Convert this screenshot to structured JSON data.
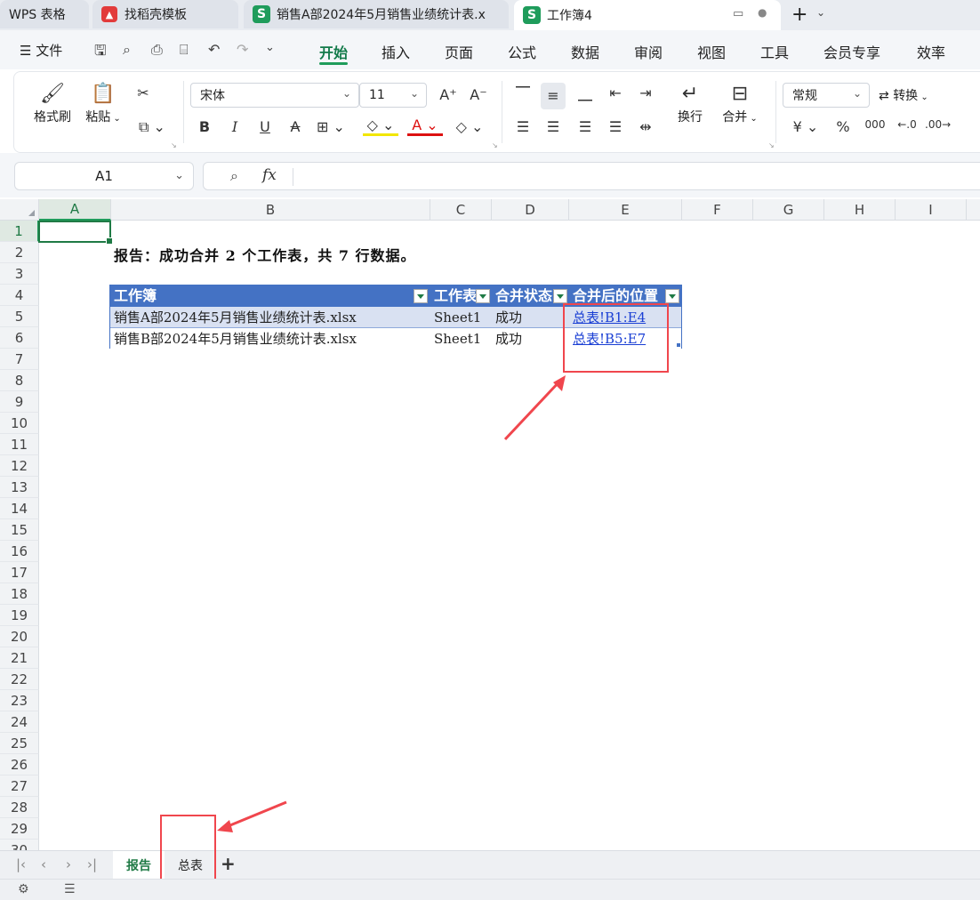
{
  "title_tabs": [
    {
      "label": "WPS 表格",
      "icon": "wps-icon"
    },
    {
      "label": "找稻壳模板",
      "icon": "docer-icon"
    },
    {
      "label": "销售A部2024年5月销售业绩统计表.x",
      "icon": "sheet-icon",
      "icon_text": "S"
    },
    {
      "label": "工作簿4",
      "icon": "sheet-icon",
      "icon_text": "S"
    }
  ],
  "menu": {
    "file": "文件",
    "items": [
      "开始",
      "插入",
      "页面",
      "公式",
      "数据",
      "审阅",
      "视图",
      "工具",
      "会员专享",
      "效率"
    ],
    "active": "开始"
  },
  "ribbon": {
    "format_painter": "格式刷",
    "paste": "粘贴",
    "font_name": "宋体",
    "font_size": "11",
    "wrap": "换行",
    "merge": "合并",
    "number_format": "常规",
    "convert": "转换",
    "bold": "B",
    "italic": "I",
    "underline": "U",
    "strike": "A",
    "font_color": "A",
    "currency": "¥",
    "percent": "%",
    "thousands": "000"
  },
  "formula_bar": {
    "cell_ref": "A1",
    "fx": "fx",
    "formula": ""
  },
  "grid": {
    "columns": [
      "A",
      "B",
      "C",
      "D",
      "E",
      "F",
      "G",
      "H",
      "I"
    ],
    "rows": [
      "1",
      "2",
      "3",
      "4",
      "5",
      "6",
      "7",
      "8",
      "9",
      "10",
      "11",
      "12",
      "13",
      "14",
      "15",
      "16",
      "17",
      "18",
      "19",
      "20",
      "21",
      "22",
      "23",
      "24",
      "25",
      "26",
      "27",
      "28",
      "29",
      "30"
    ],
    "selected_col": "A",
    "selected_row": "1"
  },
  "report_text": "报告：成功合并 2 个工作表，共 7 行数据。",
  "table": {
    "headers": [
      "工作簿",
      "工作表",
      "合并状态",
      "合并后的位置"
    ],
    "rows": [
      [
        "销售A部2024年5月销售业绩统计表.xlsx",
        "Sheet1",
        "成功",
        "总表!B1:E4"
      ],
      [
        "销售B部2024年5月销售业绩统计表.xlsx",
        "Sheet1",
        "成功",
        "总表!B5:E7"
      ]
    ],
    "header_color": "#4472c4",
    "band_color": "#d9e1f2",
    "link_color": "#1a3fd4"
  },
  "sheets": {
    "tabs": [
      "报告",
      "总表"
    ],
    "active": "报告"
  },
  "annotation_color": "#f0464d"
}
